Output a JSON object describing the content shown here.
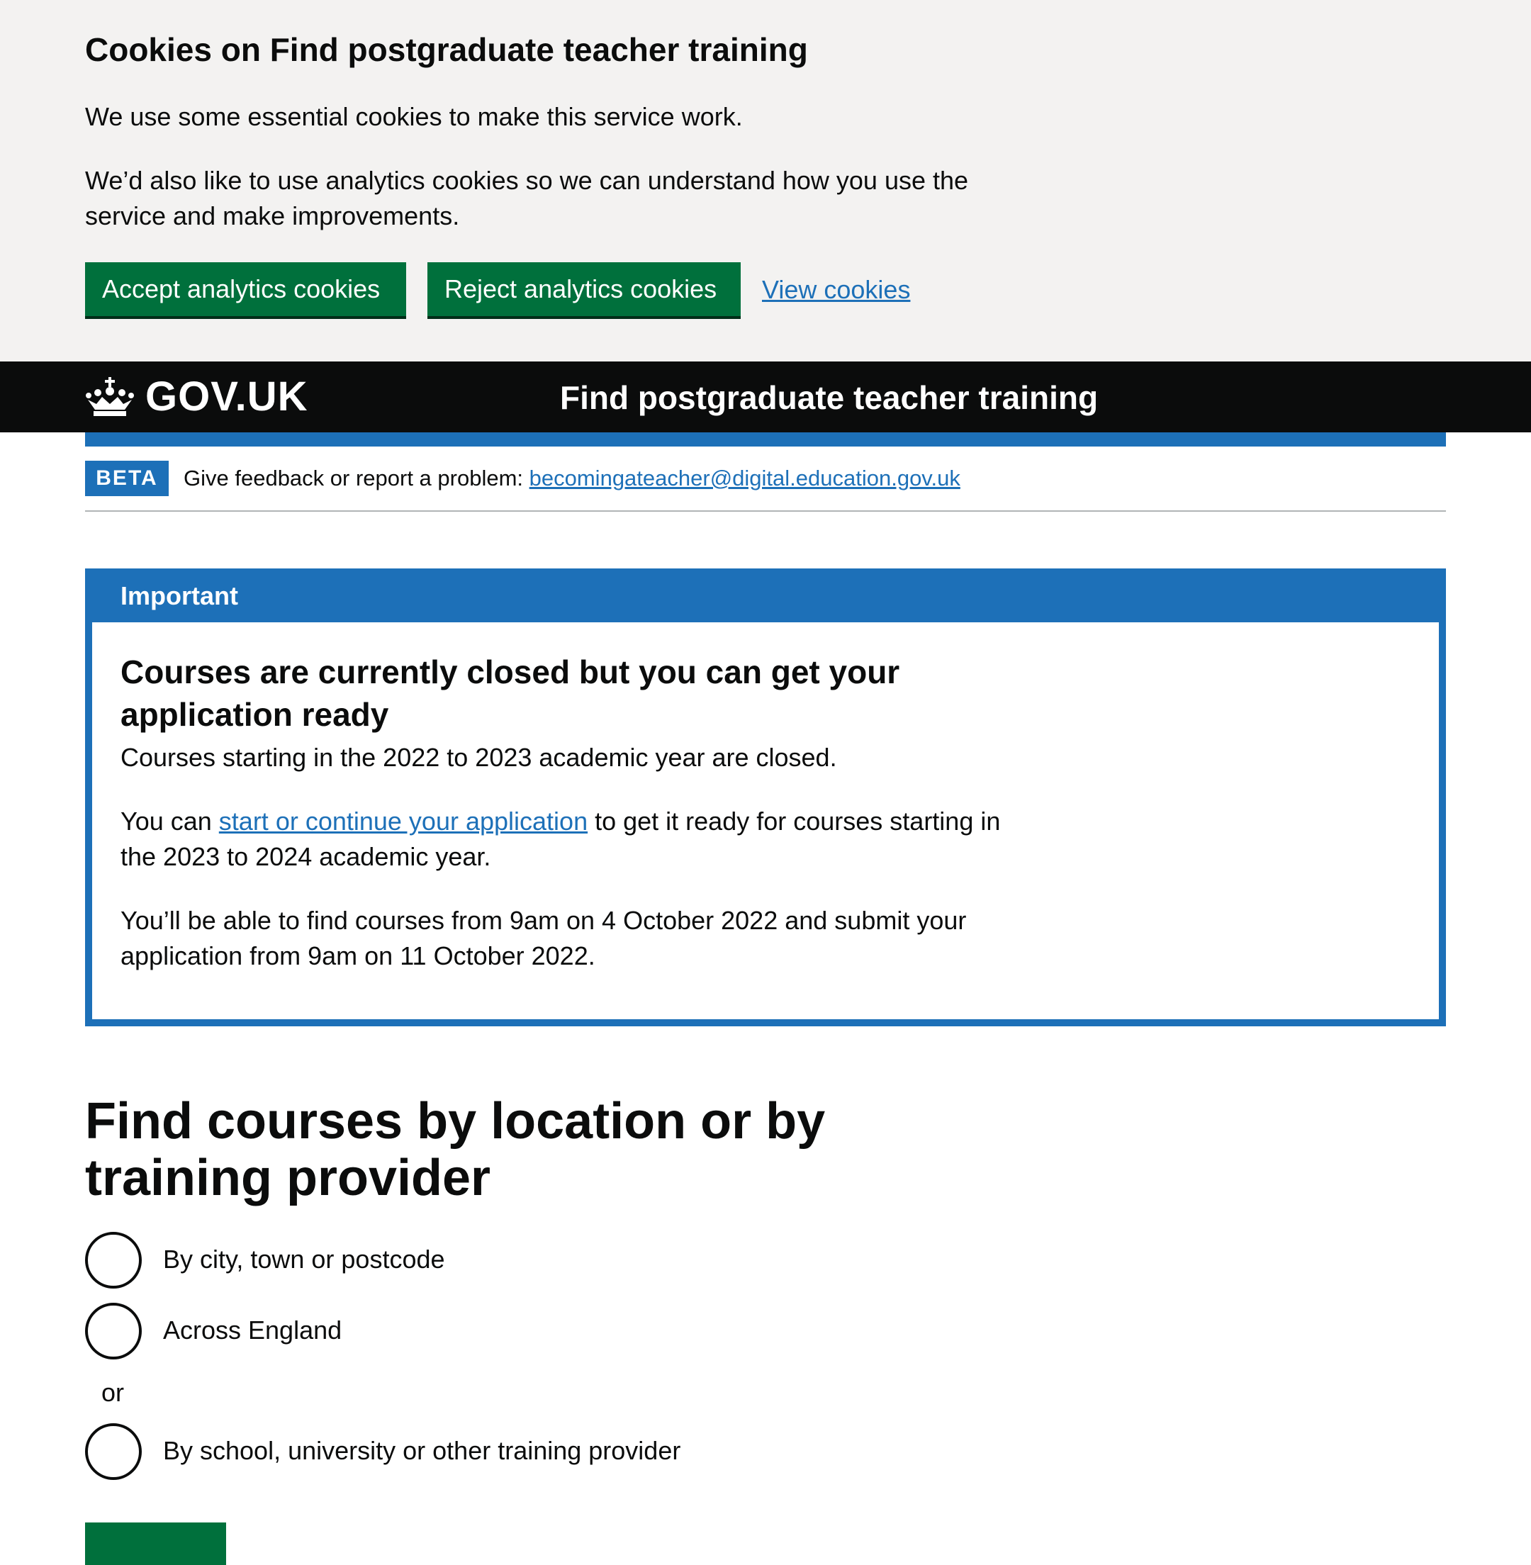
{
  "cookie_banner": {
    "heading": "Cookies on Find postgraduate teacher training",
    "paragraph_1": "We use some essential cookies to make this service work.",
    "paragraph_2": "We’d also like to use analytics cookies so we can understand how you use the service and make improvements.",
    "accept_label": "Accept analytics cookies",
    "reject_label": "Reject analytics cookies",
    "view_label": "View cookies"
  },
  "header": {
    "logo_text": "GOV.UK",
    "service_name": "Find postgraduate teacher training"
  },
  "phase_banner": {
    "tag": "BETA",
    "text": "Give feedback or report a problem: ",
    "email": "becomingateacher@digital.education.gov.uk"
  },
  "important": {
    "title": "Important",
    "heading": "Courses are currently closed but you can get your application ready",
    "p1": "Courses starting in the 2022 to 2023 academic year are closed.",
    "p2_before": "You can ",
    "p2_link": "start or continue your application",
    "p2_after": " to get it ready for courses starting in the 2023 to 2024 academic year.",
    "p3": "You’ll be able to find courses from 9am on 4 October 2022 and submit your application from 9am on 11 October 2022."
  },
  "main": {
    "heading": "Find courses by location or by training provider",
    "options": [
      "By city, town or postcode",
      "Across England",
      "By school, university or other training provider"
    ],
    "divider": "or"
  },
  "colors": {
    "button_green": "#00703c",
    "link_blue": "#1d70b8",
    "banner_grey": "#f3f2f1",
    "header_black": "#0b0c0c"
  }
}
